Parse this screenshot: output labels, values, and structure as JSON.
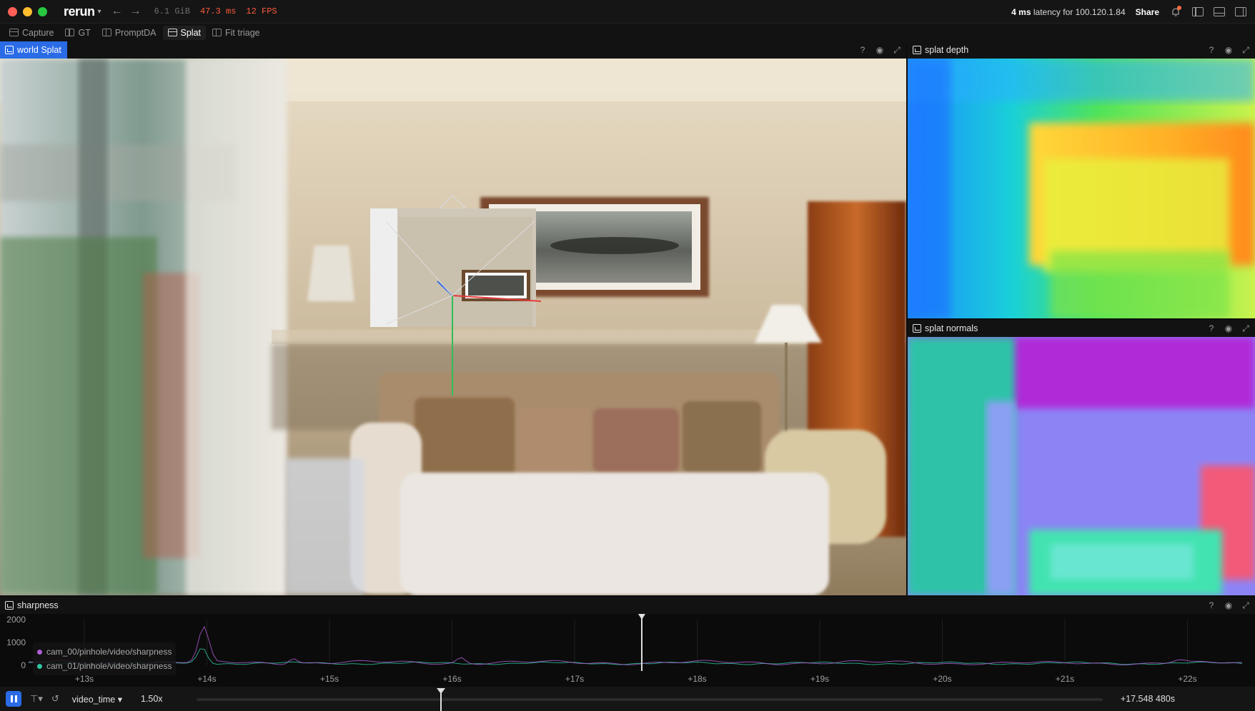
{
  "titlebar": {
    "app_name": "rerun",
    "memory": "6.1 GiB",
    "latency_ms": "47.3 ms",
    "fps": "12 FPS",
    "latency_prefix": "4 ms",
    "latency_suffix": "latency for 100.120.1.84",
    "share_label": "Share"
  },
  "tabs": [
    {
      "label": "Capture",
      "icon": "rows-icon"
    },
    {
      "label": "GT",
      "icon": "columns-icon"
    },
    {
      "label": "PromptDA",
      "icon": "columns-icon"
    },
    {
      "label": "Splat",
      "icon": "rows-icon",
      "active": true
    },
    {
      "label": "Fit triage",
      "icon": "columns-icon"
    }
  ],
  "views": {
    "main": {
      "title": "world Splat"
    },
    "depth": {
      "title": "splat depth"
    },
    "normals": {
      "title": "splat normals"
    },
    "plot": {
      "title": "sharpness"
    }
  },
  "header_actions": {
    "help": "?",
    "visibility": "eye-icon",
    "maximize": "expand-icon"
  },
  "chart_data": {
    "type": "line",
    "title": "sharpness",
    "ylim": [
      0,
      2000
    ],
    "y_ticks": [
      "2000",
      "1000",
      "0"
    ],
    "x_ticks": [
      "+13s",
      "+14s",
      "+15s",
      "+16s",
      "+17s",
      "+18s",
      "+19s",
      "+20s",
      "+21s",
      "+22s"
    ],
    "series": [
      {
        "name": "cam_00/pinhole/video/sharpness",
        "color": "#b05fd8"
      },
      {
        "name": "cam_01/pinhole/video/sharpness",
        "color": "#2fc7a0"
      }
    ],
    "cursor_x": "+17.548s"
  },
  "timeline": {
    "timeline_name": "video_time",
    "speed": "1.50x",
    "current_time": "+17.548 480s"
  },
  "colors": {
    "accent": "#2a6be6",
    "fps_warning": "#ff5a3c"
  }
}
